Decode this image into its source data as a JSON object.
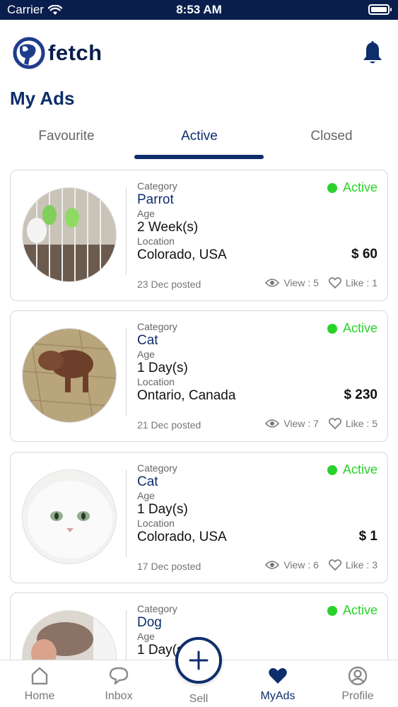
{
  "status_bar": {
    "carrier": "Carrier",
    "time": "8:53 AM"
  },
  "app": {
    "name": "fetch"
  },
  "page": {
    "title": "My Ads"
  },
  "tabs": [
    {
      "label": "Favourite",
      "active": false
    },
    {
      "label": "Active",
      "active": true
    },
    {
      "label": "Closed",
      "active": false
    }
  ],
  "labels": {
    "category": "Category",
    "age": "Age",
    "location": "Location"
  },
  "ads": [
    {
      "category": "Parrot",
      "age": "2 Week(s)",
      "location": "Colorado, USA",
      "status": "Active",
      "price": "$ 60",
      "posted": "23 Dec posted",
      "views": "View : 5",
      "likes": "Like : 1",
      "photo_icon": "parrot-photo"
    },
    {
      "category": "Cat",
      "age": "1 Day(s)",
      "location": "Ontario, Canada",
      "status": "Active",
      "price": "$ 230",
      "posted": "21 Dec posted",
      "views": "View : 7",
      "likes": "Like : 5",
      "photo_icon": "puppy-photo"
    },
    {
      "category": "Cat",
      "age": "1 Day(s)",
      "location": "Colorado, USA",
      "status": "Active",
      "price": "$ 1",
      "posted": "17 Dec posted",
      "views": "View : 6",
      "likes": "Like : 3",
      "photo_icon": "white-cat-photo"
    },
    {
      "category": "Dog",
      "age": "1 Day(s)",
      "location": "",
      "status": "Active",
      "price": "",
      "posted": "",
      "views": "",
      "likes": "",
      "photo_icon": "dog-photo"
    }
  ],
  "nav": [
    {
      "label": "Home",
      "icon": "home-icon",
      "active": false
    },
    {
      "label": "Inbox",
      "icon": "chat-bubble-icon",
      "active": false
    },
    {
      "label": "Sell",
      "icon": "plus-icon",
      "active": false
    },
    {
      "label": "MyAds",
      "icon": "heart-icon",
      "active": true
    },
    {
      "label": "Profile",
      "icon": "profile-icon",
      "active": false
    }
  ],
  "colors": {
    "brand": "#0e2d6b",
    "status_bar": "#0a1e4d",
    "active_status": "#2ad12a",
    "text_muted": "#777777"
  }
}
